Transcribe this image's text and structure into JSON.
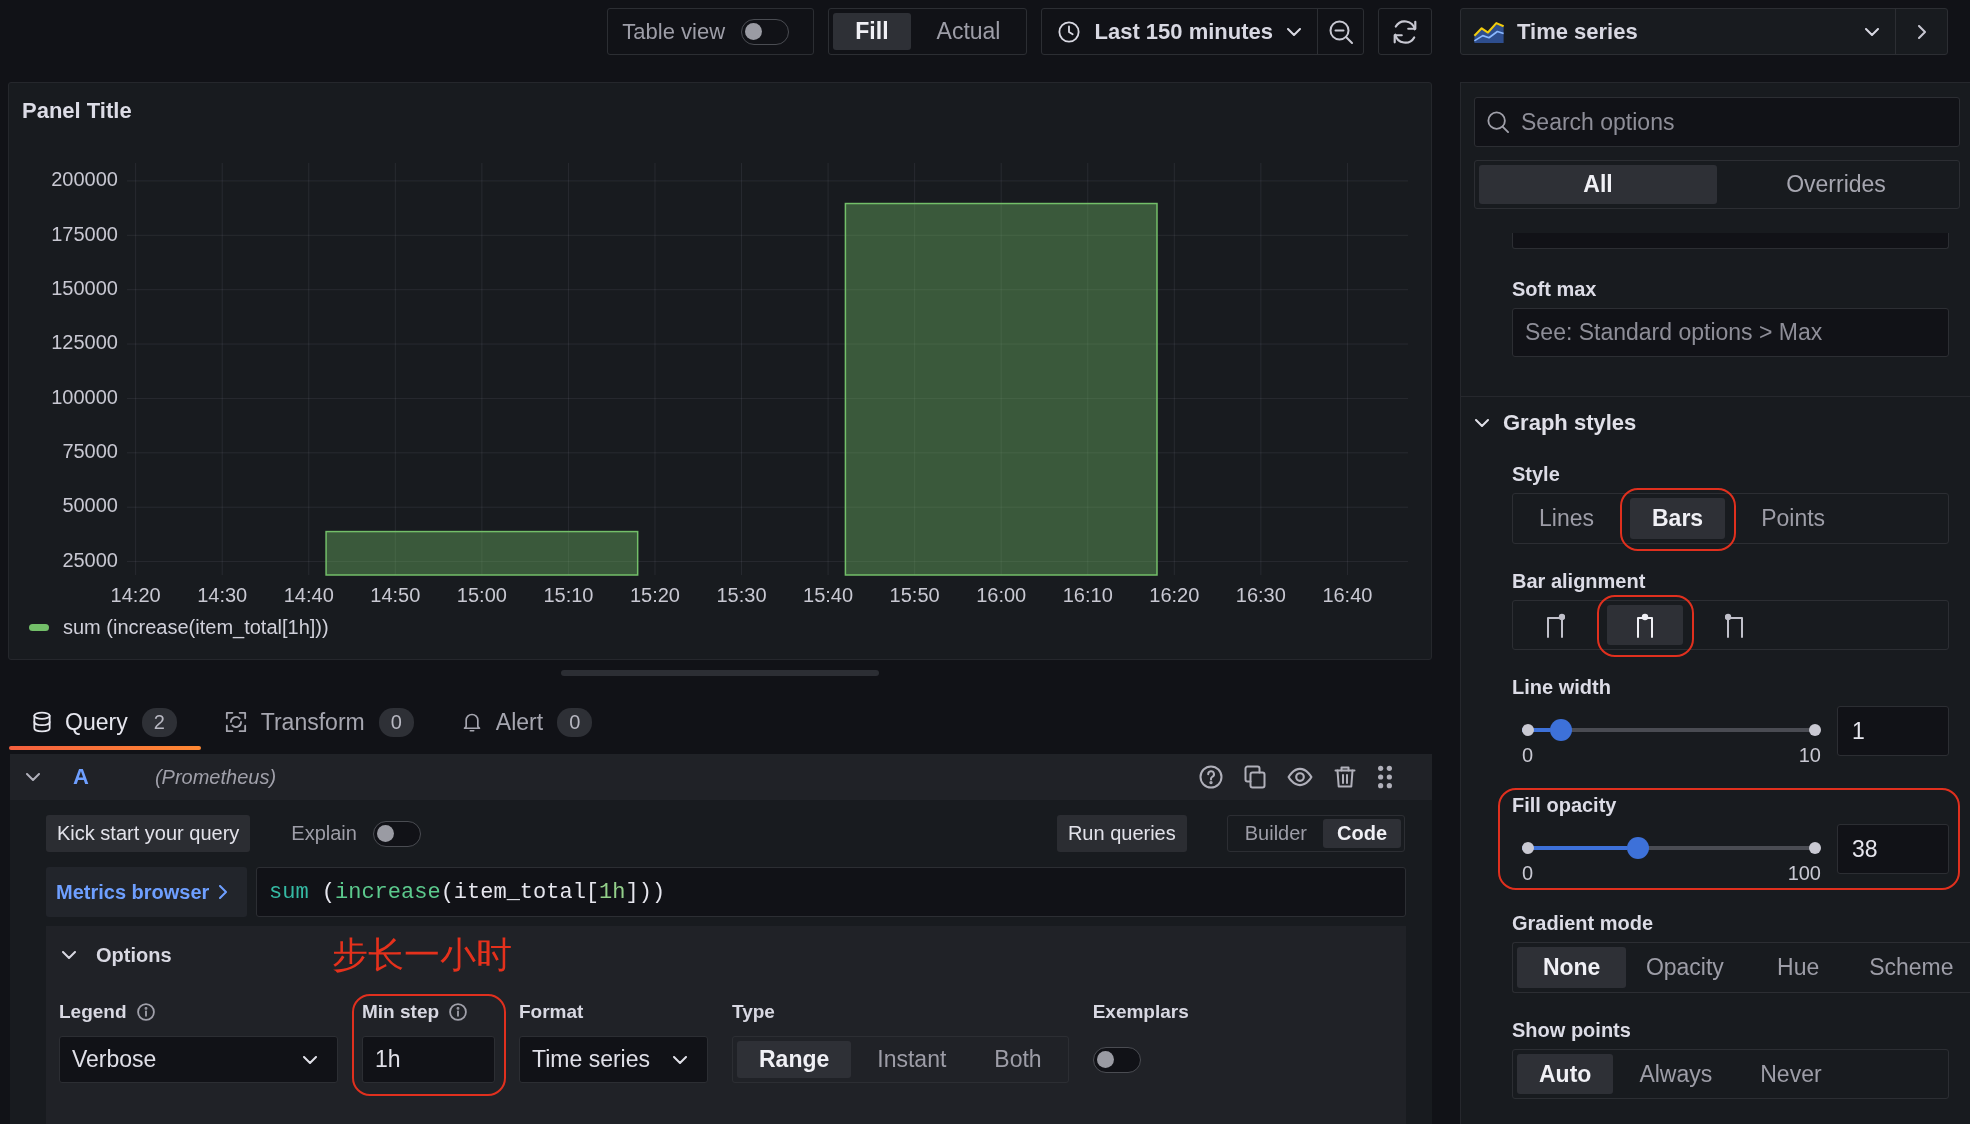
{
  "toolbar": {
    "table_view": {
      "label": "Table view",
      "on": false
    },
    "fill_mode": [
      {
        "label": "Fill",
        "selected": true
      },
      {
        "label": "Actual",
        "selected": false
      }
    ],
    "time_range": {
      "label": "Last 150 minutes"
    },
    "visualization": {
      "label": "Time series"
    }
  },
  "panel": {
    "title": "Panel Title",
    "chart_data": {
      "type": "bar",
      "x": [
        900,
        960
      ],
      "series": [
        {
          "name": "sum (increase(item_total[1h]))",
          "color": "#73bf69",
          "values": [
            38800,
            189600
          ]
        }
      ],
      "xlim": [
        859,
        1007
      ],
      "ylim": [
        18840,
        208230
      ],
      "xticks": [
        {
          "value": 860,
          "label": "14:20"
        },
        {
          "value": 870,
          "label": "14:30"
        },
        {
          "value": 880,
          "label": "14:40"
        },
        {
          "value": 890,
          "label": "14:50"
        },
        {
          "value": 900,
          "label": "15:00"
        },
        {
          "value": 910,
          "label": "15:10"
        },
        {
          "value": 920,
          "label": "15:20"
        },
        {
          "value": 930,
          "label": "15:30"
        },
        {
          "value": 940,
          "label": "15:40"
        },
        {
          "value": 950,
          "label": "15:50"
        },
        {
          "value": 960,
          "label": "16:00"
        },
        {
          "value": 970,
          "label": "16:10"
        },
        {
          "value": 980,
          "label": "16:20"
        },
        {
          "value": 990,
          "label": "16:30"
        },
        {
          "value": 1000,
          "label": "16:40"
        }
      ],
      "yticks": [
        25000,
        50000,
        75000,
        100000,
        125000,
        150000,
        175000,
        200000
      ],
      "grid": true
    }
  },
  "query_tabs": [
    {
      "label": "Query",
      "count": "2",
      "selected": true
    },
    {
      "label": "Transform",
      "count": "0",
      "selected": false
    },
    {
      "label": "Alert",
      "count": "0",
      "selected": false
    }
  ],
  "query": {
    "ref_id": "A",
    "datasource": "(Prometheus)",
    "expanded": true,
    "kick_start": "Kick start your query",
    "explain": {
      "label": "Explain",
      "on": false
    },
    "run_queries": "Run queries",
    "editor_mode": [
      {
        "label": "Builder",
        "selected": false
      },
      {
        "label": "Code",
        "selected": true
      }
    ],
    "metrics_browser": "Metrics browser",
    "expression": [
      {
        "text": "sum",
        "kind": "aggregation"
      },
      {
        "text": " (",
        "kind": "plain"
      },
      {
        "text": "increase",
        "kind": "function"
      },
      {
        "text": "(item_total[",
        "kind": "plain"
      },
      {
        "text": "1h",
        "kind": "duration"
      },
      {
        "text": "]))",
        "kind": "plain"
      }
    ],
    "options": {
      "title": "Options",
      "expanded": true,
      "annotation": "步长一小时",
      "legend": {
        "label": "Legend",
        "info": true,
        "value": "Verbose"
      },
      "min_step": {
        "label": "Min step",
        "info": true,
        "value": "1h",
        "annotated": true
      },
      "format": {
        "label": "Format",
        "value": "Time series"
      },
      "type": {
        "label": "Type",
        "choices": [
          {
            "label": "Range",
            "selected": true
          },
          {
            "label": "Instant",
            "selected": false
          },
          {
            "label": "Both",
            "selected": false
          }
        ]
      },
      "exemplars": {
        "label": "Exemplars",
        "on": false
      }
    }
  },
  "options_pane": {
    "search": {
      "placeholder": "Search options"
    },
    "tabs": [
      {
        "label": "All",
        "selected": true
      },
      {
        "label": "Overrides",
        "selected": false
      }
    ],
    "soft_max": {
      "label": "Soft max",
      "placeholder": "See: Standard options > Max"
    },
    "graph_styles": {
      "title": "Graph styles",
      "expanded": true,
      "style": {
        "label": "Style",
        "choices": [
          {
            "label": "Lines",
            "selected": false,
            "annotated": false
          },
          {
            "label": "Bars",
            "selected": true,
            "annotated": true
          },
          {
            "label": "Points",
            "selected": false,
            "annotated": false
          }
        ]
      },
      "bar_alignment": {
        "label": "Bar alignment",
        "choices": [
          {
            "kind": "before",
            "selected": false,
            "annotated": false
          },
          {
            "kind": "center",
            "selected": true,
            "annotated": true
          },
          {
            "kind": "after",
            "selected": false,
            "annotated": false
          }
        ]
      },
      "line_width": {
        "label": "Line width",
        "level": 0.1,
        "min": "0",
        "max": "10",
        "value": "1"
      },
      "fill_opacity": {
        "label": "Fill opacity",
        "level": 0.38,
        "min": "0",
        "max": "100",
        "value": "38",
        "annotated": true
      },
      "gradient_mode": {
        "label": "Gradient mode",
        "choices": [
          {
            "label": "None",
            "selected": true
          },
          {
            "label": "Opacity",
            "selected": false
          },
          {
            "label": "Hue",
            "selected": false
          },
          {
            "label": "Scheme",
            "selected": false
          }
        ]
      },
      "show_points": {
        "label": "Show points",
        "choices": [
          {
            "label": "Auto",
            "selected": true
          },
          {
            "label": "Always",
            "selected": false
          },
          {
            "label": "Never",
            "selected": false
          }
        ]
      }
    }
  }
}
